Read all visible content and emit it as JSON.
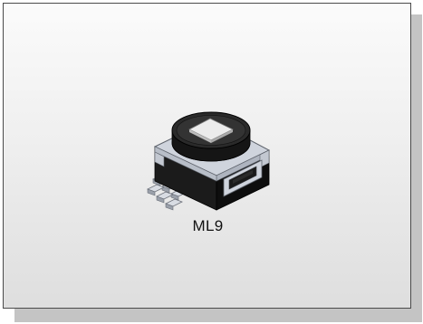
{
  "component": {
    "label": "ML9",
    "icon": "rotary-encoder-component-icon"
  },
  "colors": {
    "card_border": "#4a4a4a",
    "shadow": "#c4c4c4",
    "body_black": "#141414",
    "metal_frame": "#c9ced8",
    "knob_top": "#e8e8e8"
  }
}
